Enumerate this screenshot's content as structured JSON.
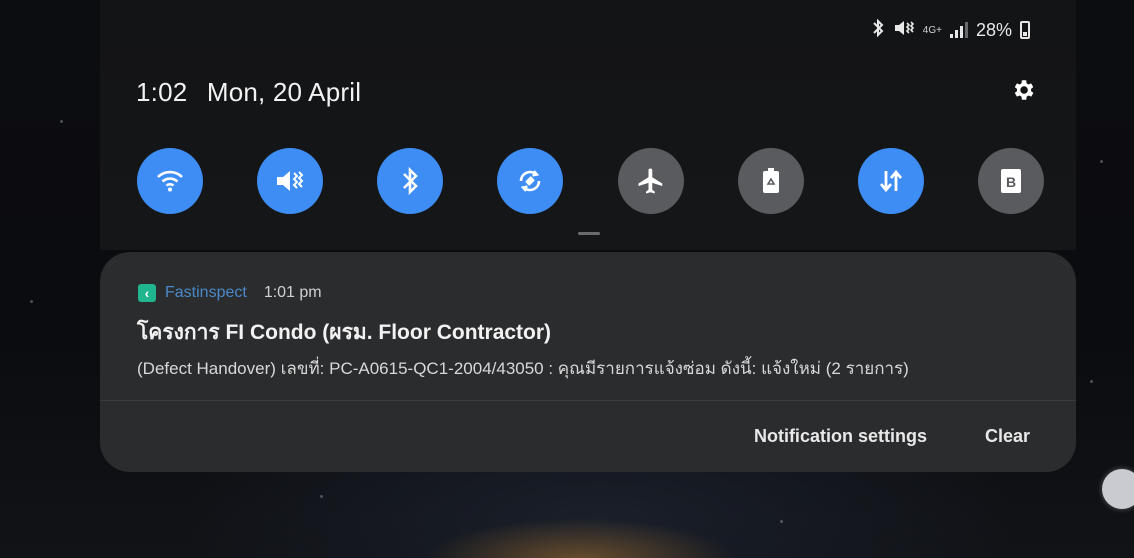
{
  "status_bar": {
    "bluetooth_icon": "bluetooth-icon",
    "mute_icon": "vibrate-mute-icon",
    "network_label": "4G+",
    "signal_icon": "signal-bars-icon",
    "battery_percent": "28%",
    "battery_level": 0.28
  },
  "header": {
    "time": "1:02",
    "date": "Mon, 20 April",
    "settings_icon": "gear-icon"
  },
  "quick_tiles": [
    {
      "name": "wifi",
      "icon": "wifi-icon",
      "state": "on"
    },
    {
      "name": "sound",
      "icon": "vibrate-mute-icon",
      "state": "on"
    },
    {
      "name": "bluetooth",
      "icon": "bluetooth-icon",
      "state": "on"
    },
    {
      "name": "auto-rotate",
      "icon": "rotate-icon",
      "state": "on"
    },
    {
      "name": "airplane-mode",
      "icon": "airplane-icon",
      "state": "off"
    },
    {
      "name": "power-saving",
      "icon": "battery-recycle-icon",
      "state": "off"
    },
    {
      "name": "mobile-data",
      "icon": "data-arrows-icon",
      "state": "on"
    },
    {
      "name": "bixby-routines",
      "icon": "b-book-icon",
      "state": "off",
      "glyph": "B"
    }
  ],
  "notification": {
    "app_name": "Fastinspect",
    "time": "1:01 pm",
    "title": "โครงการ FI Condo (ผรม. Floor Contractor)",
    "body": "(Defect Handover) เลขที่: PC-A0615-QC1-2004/43050 : คุณมีรายการแจ้งซ่อม ดังนี้: แจ้งใหม่ (2 รายการ)",
    "actions": {
      "settings_label": "Notification settings",
      "clear_label": "Clear"
    }
  },
  "colors": {
    "tile_on": "#3d8df5",
    "tile_off": "#5a5b5f",
    "card_bg": "#2b2c2e",
    "app_name": "#4a88c9"
  }
}
